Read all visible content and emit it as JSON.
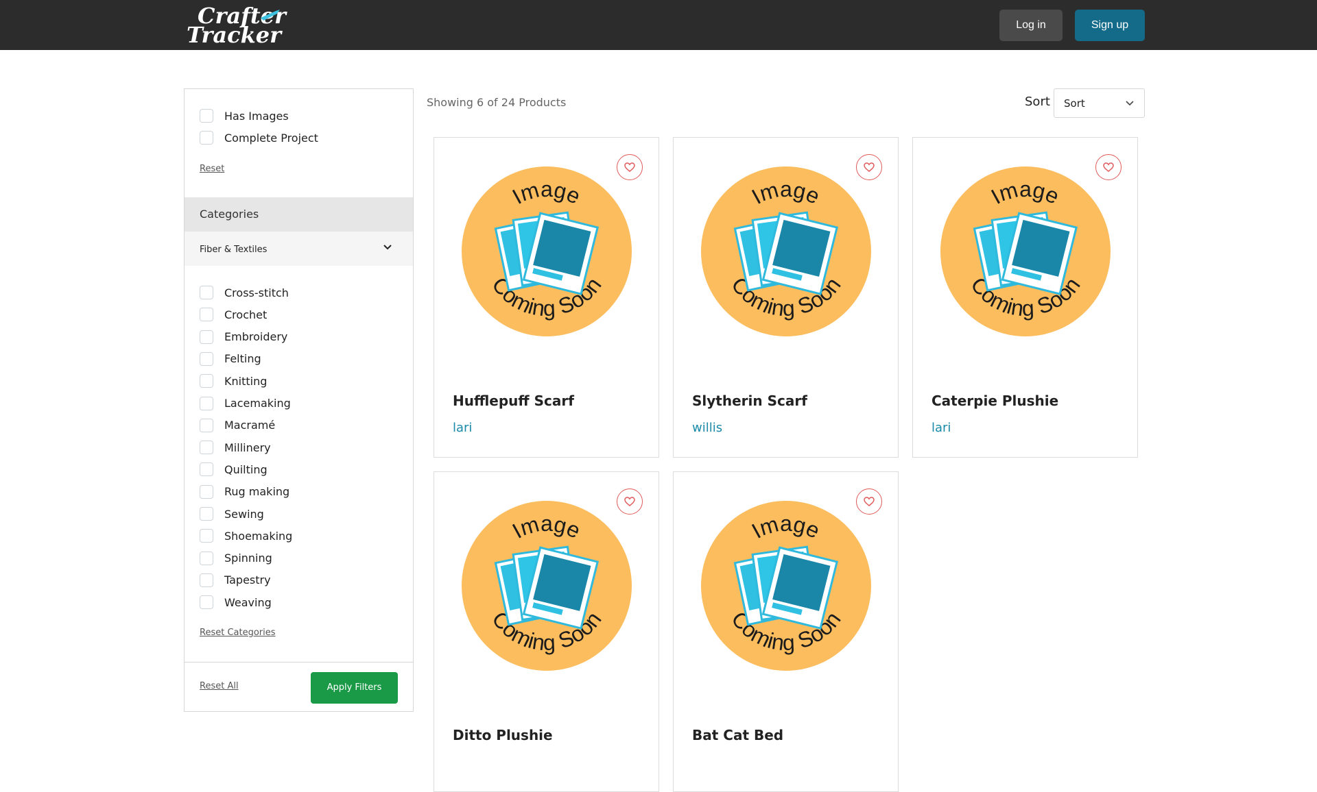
{
  "header": {
    "logo_line1": "Crafter",
    "logo_line2": "Tracker",
    "login_label": "Log in",
    "signup_label": "Sign up"
  },
  "filters": {
    "toggles": [
      {
        "label": "Has Images",
        "checked": false
      },
      {
        "label": "Complete Project",
        "checked": false
      }
    ],
    "reset_label": "Reset",
    "categories_title": "Categories",
    "category_group": "Fiber & Textiles",
    "category_items": [
      {
        "label": "Cross-stitch",
        "checked": false
      },
      {
        "label": "Crochet",
        "checked": false
      },
      {
        "label": "Embroidery",
        "checked": false
      },
      {
        "label": "Felting",
        "checked": false
      },
      {
        "label": "Knitting",
        "checked": false
      },
      {
        "label": "Lacemaking",
        "checked": false
      },
      {
        "label": "Macramé",
        "checked": false
      },
      {
        "label": "Millinery",
        "checked": false
      },
      {
        "label": "Quilting",
        "checked": false
      },
      {
        "label": "Rug making",
        "checked": false
      },
      {
        "label": "Sewing",
        "checked": false
      },
      {
        "label": "Shoemaking",
        "checked": false
      },
      {
        "label": "Spinning",
        "checked": false
      },
      {
        "label": "Tapestry",
        "checked": false
      },
      {
        "label": "Weaving",
        "checked": false
      }
    ],
    "reset_categories_label": "Reset Categories",
    "reset_all_label": "Reset All",
    "apply_label": "Apply Filters"
  },
  "results": {
    "showing_text": "Showing 6 of 24 Products",
    "sort_label": "Sort",
    "sort_value": "Sort"
  },
  "products": [
    {
      "title": "Hufflepuff Scarf",
      "author": "lari",
      "image_text_top": "Image",
      "image_text_bottom": "Coming Soon"
    },
    {
      "title": "Slytherin Scarf",
      "author": "willis",
      "image_text_top": "Image",
      "image_text_bottom": "Coming Soon"
    },
    {
      "title": "Caterpie Plushie",
      "author": "lari",
      "image_text_top": "Image",
      "image_text_bottom": "Coming Soon"
    },
    {
      "title": "Ditto Plushie",
      "author": "",
      "image_text_top": "Image",
      "image_text_bottom": "Coming Soon"
    },
    {
      "title": "Bat Cat Bed",
      "author": "",
      "image_text_top": "Image",
      "image_text_bottom": "Coming Soon"
    }
  ],
  "colors": {
    "topbar": "#2c2c2c",
    "signup": "#146b89",
    "apply": "#1a9a46",
    "author": "#1a8aa8",
    "placeholder_circle": "#fbbd5e",
    "heart": "#e05a5a"
  }
}
